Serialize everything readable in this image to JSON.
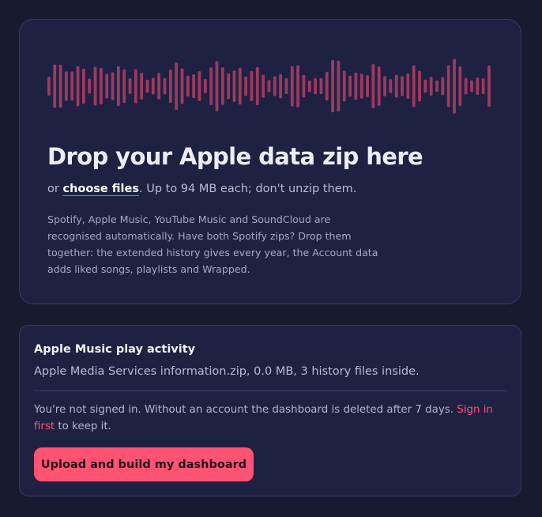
{
  "dropzone": {
    "title": "Drop your Apple data zip here",
    "prefix": "or ",
    "choose_files": "choose files",
    "size_note": ". Up to 94 MB each; don't unzip them.",
    "description": "Spotify, Apple Music, YouTube Music and SoundCloud are recognised automatically. Have both Spotify zips? Drop them together: the extended history gives every year, the Account data adds liked songs, playlists and Wrapped.",
    "waveform_color": "#9b3a60"
  },
  "file_card": {
    "title": "Apple Music play activity",
    "file_info": "Apple Media Services information.zip, 0.0 MB, 3 history files inside.",
    "notice_text": "You're not signed in. Without an account the dashboard is deleted after 7 days. ",
    "signin_link": "Sign in first",
    "notice_suffix": " to keep it.",
    "upload_button": "Upload and build my dashboard"
  },
  "colors": {
    "background": "#171a30",
    "panel": "#1f2142",
    "accent": "#ff5373"
  }
}
